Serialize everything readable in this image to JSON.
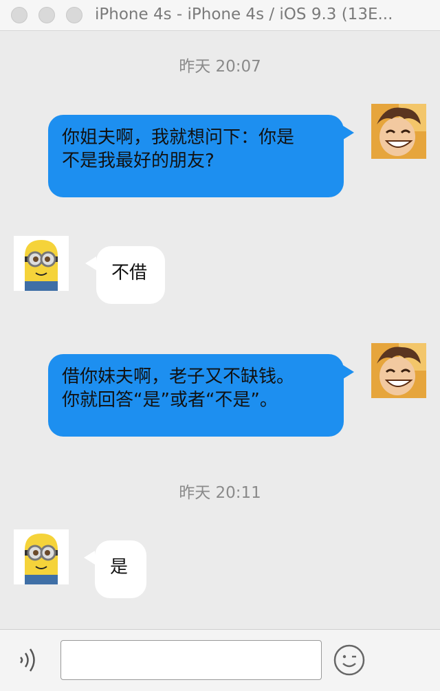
{
  "window": {
    "title": "iPhone 4s - iPhone 4s / iOS 9.3 (13E..."
  },
  "chat": {
    "timestamps": [
      "昨天 20:07",
      "昨天 20:11"
    ],
    "messages": [
      {
        "sender": "me",
        "avatar": "anime-boy-avatar",
        "lines": [
          "你姐夫啊，我就想问下：你是",
          "不是我最好的朋友?"
        ]
      },
      {
        "sender": "friend",
        "avatar": "minion-avatar",
        "lines": [
          "不借"
        ]
      },
      {
        "sender": "me",
        "avatar": "anime-boy-avatar",
        "lines": [
          "借你妹夫啊，老子又不缺钱。",
          "你就回答“是”或者“不是”。"
        ]
      },
      {
        "sender": "friend",
        "avatar": "minion-avatar",
        "lines": [
          "是"
        ]
      }
    ]
  },
  "input_bar": {
    "voice_icon": "voice-icon",
    "input_value": "",
    "emoji_icon": "emoji-wink-icon"
  },
  "colors": {
    "outgoing_bubble": "#1d8ff0",
    "incoming_bubble": "#ffffff",
    "background": "#ebebeb"
  }
}
